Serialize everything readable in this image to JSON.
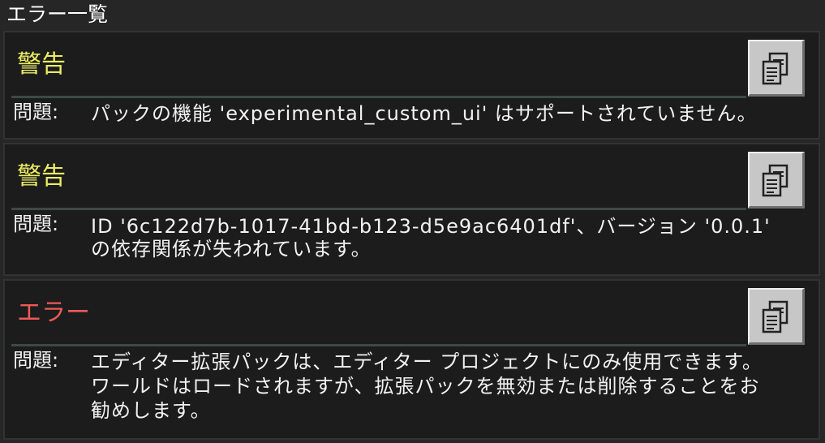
{
  "window": {
    "title": "エラー一覧"
  },
  "colors": {
    "warning": "#ecec63",
    "error": "#ee5959",
    "text": "#f2f2f2"
  },
  "entries": [
    {
      "severity": "警告",
      "label": "問題:",
      "message": "パックの機能 'experimental_custom_ui' はサポートされていません。",
      "copy_icon": "copy-icon"
    },
    {
      "severity": "警告",
      "label": "問題:",
      "message_line1": "ID '6c122d7b-1017-41bd-b123-d5e9ac6401df'、バージョン '0.0.1'",
      "message_line2": "の依存関係が失われています。",
      "copy_icon": "copy-icon"
    },
    {
      "severity": "エラー",
      "label": "問題:",
      "message": "エディター拡張パックは、エディター プロジェクトにのみ使用できます。ワールドはロードされますが、拡張パックを無効または削除することをお勧めします。",
      "copy_icon": "copy-icon"
    }
  ]
}
